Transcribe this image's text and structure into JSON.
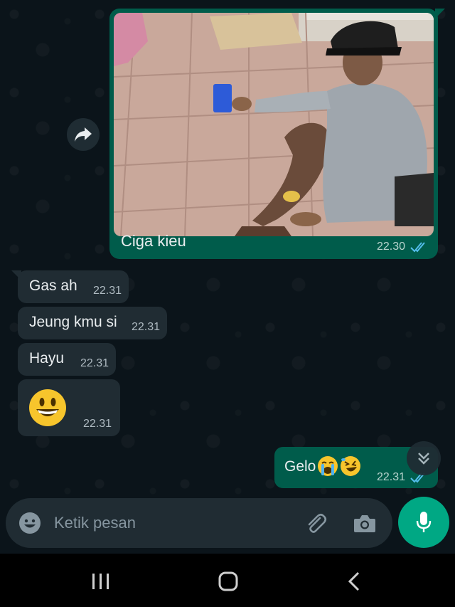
{
  "messages": {
    "image_message": {
      "caption": "Ciga kieu",
      "time": "22.30"
    },
    "incoming": [
      {
        "text": "Gas ah",
        "time": "22.31"
      },
      {
        "text": "Jeung kmu si",
        "time": "22.31"
      },
      {
        "text": "Hayu",
        "time": "22.31"
      },
      {
        "emoji": "grinning-face-emoji",
        "time": "22.31"
      }
    ],
    "outgoing_text": {
      "text": "Gelo",
      "emojis": [
        "loudly-crying-face-emoji",
        "rolling-on-floor-laughing-emoji"
      ],
      "time": "22.31"
    }
  },
  "composer": {
    "placeholder": "Ketik pesan"
  },
  "colors": {
    "background": "#0b141a",
    "incoming_bubble": "#202c33",
    "outgoing_bubble": "#005c4b",
    "accent": "#00a884",
    "read_ticks": "#53bdeb"
  }
}
